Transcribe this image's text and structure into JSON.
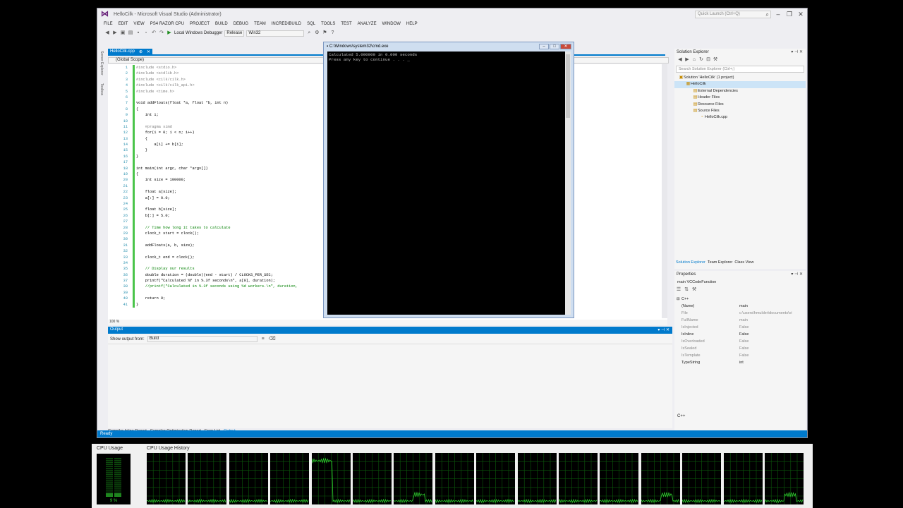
{
  "window": {
    "title": "HelloCilk - Microsoft Visual Studio (Administrator)",
    "quick_launch_placeholder": "Quick Launch (Ctrl+Q)"
  },
  "menu": [
    "FILE",
    "EDIT",
    "VIEW",
    "PS4 RAZOR CPU",
    "PROJECT",
    "BUILD",
    "DEBUG",
    "TEAM",
    "INCREDIBUILD",
    "SQL",
    "TOOLS",
    "TEST",
    "ANALYZE",
    "WINDOW",
    "HELP"
  ],
  "toolbar": {
    "debugger": "Local Windows Debugger",
    "configuration": "Release",
    "platform": "Win32"
  },
  "side_tabs": [
    "Server Explorer",
    "Toolbox"
  ],
  "editor": {
    "tab_label": "HelloCilk.cpp",
    "scope": "(Global Scope)",
    "zoom": "100 %",
    "lines": [
      {
        "n": "1",
        "t": "#include <stdio.h>",
        "c": "pp"
      },
      {
        "n": "2",
        "t": "#include <stdlib.h>",
        "c": "pp"
      },
      {
        "n": "3",
        "t": "#include <cilk/cilk.h>",
        "c": "pp"
      },
      {
        "n": "4",
        "t": "#include <cilk/cilk_api.h>",
        "c": "pp"
      },
      {
        "n": "5",
        "t": "#include <time.h>",
        "c": "pp"
      },
      {
        "n": "6",
        "t": "",
        "c": ""
      },
      {
        "n": "7",
        "t": "void addFloats(float *a, float *b, int n)",
        "c": ""
      },
      {
        "n": "8",
        "t": "{",
        "c": ""
      },
      {
        "n": "9",
        "t": "    int i;",
        "c": ""
      },
      {
        "n": "10",
        "t": "",
        "c": ""
      },
      {
        "n": "11",
        "t": "    #pragma simd",
        "c": "pp"
      },
      {
        "n": "12",
        "t": "    for(i = 0; i < n; i++)",
        "c": ""
      },
      {
        "n": "13",
        "t": "    {",
        "c": ""
      },
      {
        "n": "14",
        "t": "        a[i] += b[i];",
        "c": ""
      },
      {
        "n": "15",
        "t": "    }",
        "c": ""
      },
      {
        "n": "16",
        "t": "}",
        "c": ""
      },
      {
        "n": "17",
        "t": "",
        "c": ""
      },
      {
        "n": "18",
        "t": "int main(int argc, char *argv[])",
        "c": ""
      },
      {
        "n": "19",
        "t": "{",
        "c": ""
      },
      {
        "n": "20",
        "t": "    int size = 100000;",
        "c": ""
      },
      {
        "n": "21",
        "t": "",
        "c": ""
      },
      {
        "n": "22",
        "t": "    float a[size];",
        "c": ""
      },
      {
        "n": "23",
        "t": "    a[:] = 0.0;",
        "c": ""
      },
      {
        "n": "24",
        "t": "",
        "c": ""
      },
      {
        "n": "25",
        "t": "    float b[size];",
        "c": ""
      },
      {
        "n": "26",
        "t": "    b[:] = 5.0;",
        "c": ""
      },
      {
        "n": "27",
        "t": "",
        "c": ""
      },
      {
        "n": "28",
        "t": "    // Time how long it takes to calculate",
        "c": "cm"
      },
      {
        "n": "29",
        "t": "    clock_t start = clock();",
        "c": ""
      },
      {
        "n": "30",
        "t": "",
        "c": ""
      },
      {
        "n": "31",
        "t": "    addFloats(a, b, size);",
        "c": ""
      },
      {
        "n": "32",
        "t": "",
        "c": ""
      },
      {
        "n": "33",
        "t": "    clock_t end = clock();",
        "c": ""
      },
      {
        "n": "34",
        "t": "",
        "c": ""
      },
      {
        "n": "35",
        "t": "    // Display our results",
        "c": "cm"
      },
      {
        "n": "36",
        "t": "    double duration = (double)(end - start) / CLOCKS_PER_SEC;",
        "c": ""
      },
      {
        "n": "37",
        "t": "    printf(\"Calculated %f in %.3f seconds\\n\", a[0], duration);",
        "c": ""
      },
      {
        "n": "38",
        "t": "    //printf(\"Calculated in %.3f seconds using %d workers.\\n\", duration,",
        "c": "cm"
      },
      {
        "n": "39",
        "t": "",
        "c": ""
      },
      {
        "n": "40",
        "t": "    return 0;",
        "c": ""
      },
      {
        "n": "41",
        "t": "}",
        "c": ""
      }
    ]
  },
  "output": {
    "title": "Output",
    "show_from_label": "Show output from:",
    "source": "Build"
  },
  "bottom_tabs": [
    "Compiler Inline Report",
    "Compiler Optimization Report",
    "Error List",
    "Output"
  ],
  "status": "Ready",
  "solution_explorer": {
    "title": "Solution Explorer",
    "search_placeholder": "Search Solution Explorer (Ctrl+;)",
    "tree": [
      {
        "label": "Solution 'HelloCilk' (1 project)",
        "indent": 0,
        "sel": false
      },
      {
        "label": "HelloCilk",
        "indent": 1,
        "sel": true
      },
      {
        "label": "External Dependencies",
        "indent": 2,
        "sel": false
      },
      {
        "label": "Header Files",
        "indent": 2,
        "sel": false
      },
      {
        "label": "Resource Files",
        "indent": 2,
        "sel": false
      },
      {
        "label": "Source Files",
        "indent": 2,
        "sel": false
      },
      {
        "label": "HelloCilk.cpp",
        "indent": 3,
        "sel": false
      }
    ],
    "tabs": [
      "Solution Explorer",
      "Team Explorer",
      "Class View"
    ]
  },
  "properties": {
    "title": "Properties",
    "object": "main  VCCodeFunction",
    "category": "C++",
    "rows": [
      {
        "name": "(Name)",
        "value": "main",
        "dim": false
      },
      {
        "name": "File",
        "value": "c:\\users\\hmulder\\documents\\vi",
        "dim": true
      },
      {
        "name": "FullName",
        "value": "main",
        "dim": true
      },
      {
        "name": "IsInjected",
        "value": "False",
        "dim": true
      },
      {
        "name": "IsInline",
        "value": "False",
        "dim": false
      },
      {
        "name": "IsOverloaded",
        "value": "False",
        "dim": true
      },
      {
        "name": "IsSealed",
        "value": "False",
        "dim": true
      },
      {
        "name": "IsTemplate",
        "value": "False",
        "dim": true
      },
      {
        "name": "TypeString",
        "value": "int",
        "dim": false
      }
    ],
    "description": "C++"
  },
  "cmd": {
    "title": "C:\\Windows\\system32\\cmd.exe",
    "output": "Calculated 5.000000 in 0.000 seconds\nPress any key to continue . . . _"
  },
  "task_manager": {
    "cpu_usage_label": "CPU Usage",
    "cpu_history_label": "CPU Usage History",
    "cpu_percent": "9 %",
    "cpu_percent_value": 9,
    "core_count": 16
  }
}
